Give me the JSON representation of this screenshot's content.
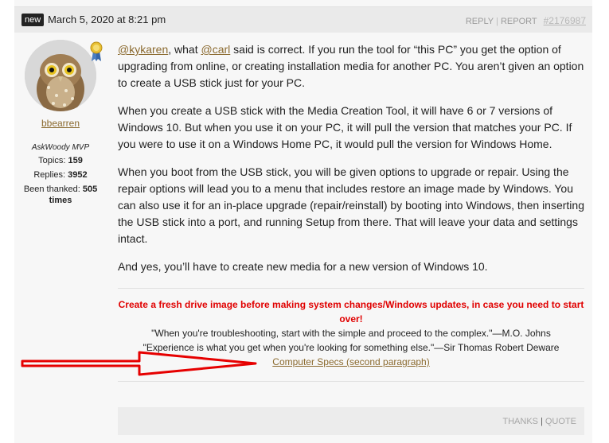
{
  "post": {
    "badge": "new",
    "date": "March 5, 2020 at 8:21 pm",
    "actions": {
      "reply": "REPLY",
      "report": "REPORT",
      "permalink": "#2176987"
    },
    "author": {
      "name": "bbearren",
      "role": "AskWoody MVP",
      "topics_label": "Topics:",
      "topics": "159",
      "replies_label": "Replies:",
      "replies": "3952",
      "thanked_label": "Been thanked:",
      "thanked": "505",
      "thanked_suffix": "times"
    },
    "content": {
      "p1_m1": "@kykaren",
      "p1_t1": ", what ",
      "p1_m2": "@carl",
      "p1_t2": " said is correct.  If you run the tool for “this PC” you get the option of upgrading from online, or creating installation media for another PC.  You aren’t given an option to create a USB stick just for your PC.",
      "p2": "When you create a USB stick with the Media Creation Tool, it will have 6 or 7 versions of Windows 10.  But when you use it on your PC, it will pull the version that matches your PC.  If you were to use it on a Windows Home PC, it would pull the version for Windows Home.",
      "p3": "When you boot from the USB stick, you will be given options to upgrade or repair.  Using the repair options will lead you to a menu that includes restore an image made by Windows.  You can also use it for an in-place upgrade (repair/reinstall) by booting into Windows, then inserting the USB stick into a port, and running Setup from there.  That will leave your data and settings intact.",
      "p4": "And yes, you’ll have to create new media for a new version of Windows 10."
    },
    "signature": {
      "warning": "Create a fresh drive image before making system changes/Windows updates, in case you need to start over!",
      "quote1": "\"When you're troubleshooting, start with the simple and proceed to the complex.\"—M.O. Johns",
      "quote2": "\"Experience is what you get when you're looking for something else.\"—Sir Thomas Robert Deware",
      "link": "Computer Specs (second paragraph)"
    },
    "footer": {
      "thanks": "THANKS",
      "quote": "QUOTE"
    }
  },
  "colors": {
    "link": "#8b6a2f",
    "warning": "#e00000",
    "annotation_arrow": "#e60000",
    "badge_bg": "#222222"
  },
  "icons": [
    "owl-avatar",
    "award-ribbon-icon",
    "red-arrow-annotation"
  ]
}
